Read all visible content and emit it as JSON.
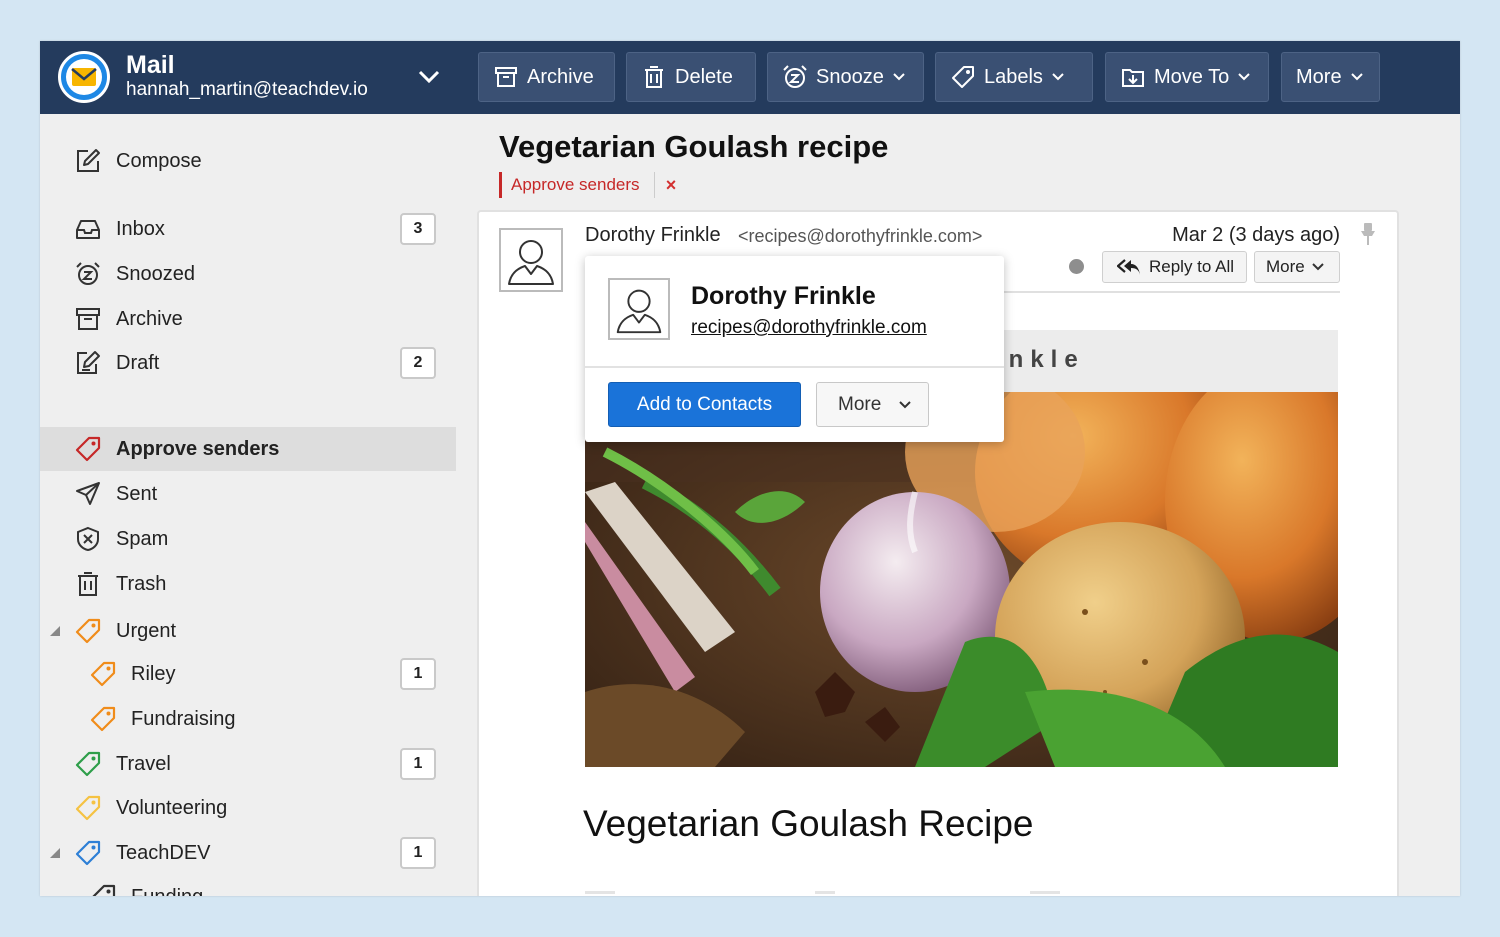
{
  "account": {
    "app_name": "Mail",
    "email": "hannah_martin@teachdev.io"
  },
  "toolbar": {
    "archive": "Archive",
    "delete": "Delete",
    "snooze": "Snooze",
    "labels": "Labels",
    "move_to": "Move To",
    "more": "More"
  },
  "sidebar": {
    "compose": "Compose",
    "items": [
      {
        "label": "Inbox",
        "badge": "3"
      },
      {
        "label": "Snoozed"
      },
      {
        "label": "Archive"
      },
      {
        "label": "Draft",
        "badge": "2"
      },
      {
        "label": "Approve senders"
      },
      {
        "label": "Sent"
      },
      {
        "label": "Spam"
      },
      {
        "label": "Trash"
      },
      {
        "label": "Urgent"
      },
      {
        "label": "Riley",
        "badge": "1"
      },
      {
        "label": "Fundraising"
      },
      {
        "label": "Travel",
        "badge": "1"
      },
      {
        "label": "Volunteering"
      },
      {
        "label": "TeachDEV",
        "badge": "1"
      },
      {
        "label": "Funding"
      }
    ]
  },
  "message": {
    "subject": "Vegetarian Goulash recipe",
    "tag": "Approve senders",
    "tag_remove": "×",
    "sender_name": "Dorothy Frinkle",
    "sender_email": "<recipes@dorothyfrinkle.com>",
    "date": "Mar 2 (3 days ago)",
    "reply_all": "Reply to All",
    "more": "More",
    "banner_fragment": "inkle",
    "body_title": "Vegetarian Goulash Recipe"
  },
  "contact_popover": {
    "name": "Dorothy Frinkle",
    "email": "recipes@dorothyfrinkle.com",
    "add_button": "Add to Contacts",
    "more_button": "More"
  },
  "colors": {
    "topbar": "#243b5d",
    "accent": "#1a73d9",
    "approve_red": "#c62828",
    "urgent_orange": "#f08c1a",
    "travel_green": "#2e9e4a",
    "volunteering_yellow": "#f5c242",
    "teachdev_blue": "#2d7fd6"
  }
}
